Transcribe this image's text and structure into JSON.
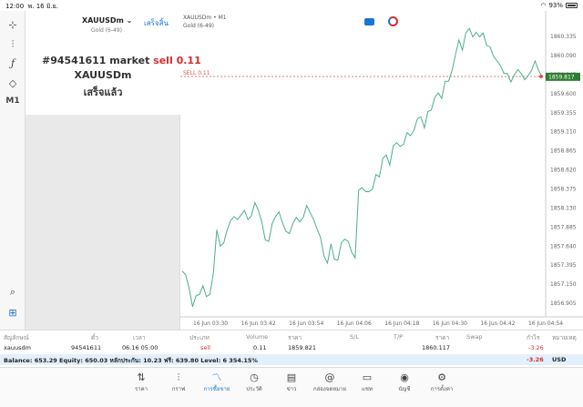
{
  "status": {
    "time": "12:00",
    "date": "พ. 16 มิ.ย.",
    "battery": "93%"
  },
  "tools": [
    {
      "icon": "crosshair-icon",
      "glyph": "-¦-"
    },
    {
      "icon": "candlestick-icon",
      "glyph": "⫶"
    },
    {
      "icon": "function-icon",
      "glyph": "ƒ"
    },
    {
      "icon": "objects-icon",
      "glyph": "◇"
    },
    {
      "label": "M1"
    }
  ],
  "panel": {
    "symbol": "XAUUSDm",
    "symbol_desc": "Gold (6-49)",
    "done_label": "เสร็จสิ้น",
    "order_prefix": "#94541611 market",
    "order_side": "sell",
    "order_volume": "0.11",
    "order_symbol": "XAUUSDm",
    "order_status": "เสร็จแล้ว"
  },
  "chart": {
    "symbol_label": "XAUUSDm • M1",
    "desc_label": "Gold (6-49)",
    "sell_line_label": "SELL 0.11",
    "current_price_label": "1859.817",
    "colors": {
      "line": "#4caf8a",
      "sell": "#d9534f",
      "price_tag": "#2e7d32"
    }
  },
  "chart_data": {
    "type": "line",
    "series": [
      {
        "values": [
          1857.32,
          1857.27,
          1857.1,
          1856.86,
          1857.0,
          1857.02,
          1857.13,
          1856.99,
          1857.02,
          1857.29,
          1857.85,
          1857.64,
          1857.68,
          1857.85,
          1857.97,
          1858.02,
          1857.98,
          1858.04,
          1858.1,
          1857.98,
          1858.03,
          1858.2,
          1858.1,
          1857.95,
          1857.72,
          1857.7,
          1857.93,
          1858.02,
          1858.08,
          1857.94,
          1857.83,
          1857.8,
          1857.93,
          1858.01,
          1857.95,
          1858.01,
          1858.16,
          1858.07,
          1857.98,
          1857.86,
          1857.75,
          1857.51,
          1857.42,
          1857.67,
          1857.47,
          1857.46,
          1857.68,
          1857.73,
          1857.7,
          1857.56,
          1857.49,
          1858.36,
          1858.39,
          1858.34,
          1858.34,
          1858.37,
          1858.56,
          1858.53,
          1858.77,
          1858.81,
          1858.68,
          1858.93,
          1858.97,
          1858.92,
          1858.95,
          1859.1,
          1859.06,
          1859.13,
          1859.28,
          1859.3,
          1859.16,
          1859.37,
          1859.39,
          1859.55,
          1859.61,
          1859.54,
          1859.76,
          1859.76,
          1859.9,
          1860.1,
          1860.29,
          1860.16,
          1860.38,
          1860.44,
          1860.33,
          1860.39,
          1860.33,
          1860.38,
          1860.22,
          1860.2,
          1860.08,
          1860.02,
          1859.96,
          1859.86,
          1859.86,
          1859.75,
          1859.84,
          1859.91,
          1859.86,
          1859.78,
          1859.83,
          1859.9,
          1860.02,
          1859.9,
          1859.82
        ]
      }
    ],
    "x_tick_labels": [
      "16 Jun 03:30",
      "16 Jun 03:42",
      "16 Jun 03:54",
      "16 Jun 04:06",
      "16 Jun 04:18",
      "16 Jun 04:30",
      "16 Jun 04:42",
      "16 Jun 04:54"
    ],
    "y_tick_labels": [
      "1860.335",
      "1860.090",
      "1859.845",
      "1859.600",
      "1859.355",
      "1859.110",
      "1858.865",
      "1858.620",
      "1858.375",
      "1858.130",
      "1857.885",
      "1857.640",
      "1857.395",
      "1857.150",
      "1856.905"
    ],
    "y_ticks": [
      1860.335,
      1860.09,
      1859.845,
      1859.6,
      1859.355,
      1859.11,
      1858.865,
      1858.62,
      1858.375,
      1858.13,
      1857.885,
      1857.64,
      1857.395,
      1857.15,
      1856.905
    ],
    "ylim": [
      1856.8,
      1860.5
    ],
    "sell_level": 1859.821,
    "current_price": 1859.817,
    "grid": false
  },
  "table": {
    "headers": [
      "สัญลักษณ์",
      "ตั๋ว",
      "เวลา",
      "ประเภท",
      "Volume",
      "ราคา",
      "S/L",
      "T/P",
      "ราคา",
      "Swap",
      "กำไร",
      "หมายเหตุ"
    ],
    "row": {
      "symbol": "xauusdm",
      "ticket": "94541611",
      "time": "06.16 05:00",
      "type": "sell",
      "volume": "0.11",
      "price": "1859.821",
      "sl": "",
      "tp": "",
      "current": "1860.117",
      "swap": "",
      "profit": "-3.26",
      "comment": ""
    },
    "balance_text": "Balance: 653.29 Equity: 650.03 หลักประกัน: 10.23 ฟรี: 639.80 Level: 6 354.15%",
    "balance_profit": "-3.26",
    "currency": "USD"
  },
  "tabs": [
    {
      "label": "ราคา",
      "icon": "quotes-icon",
      "glyph": "⇅"
    },
    {
      "label": "กราฟ",
      "icon": "chart-icon",
      "glyph": "⫶"
    },
    {
      "label": "การซื้อขาย",
      "icon": "trade-icon",
      "glyph": "⌁",
      "active": true
    },
    {
      "label": "ประวัติ",
      "icon": "history-icon",
      "glyph": "◷"
    },
    {
      "label": "ข่าว",
      "icon": "news-icon",
      "glyph": "▤"
    },
    {
      "label": "กล่องจดหมาย",
      "icon": "mailbox-icon",
      "glyph": "@"
    },
    {
      "label": "แชท",
      "icon": "chat-icon",
      "glyph": "▭"
    },
    {
      "label": "บัญชี",
      "icon": "account-icon",
      "glyph": "◉"
    },
    {
      "label": "การตั้งค่า",
      "icon": "settings-icon",
      "glyph": "⚙"
    }
  ]
}
